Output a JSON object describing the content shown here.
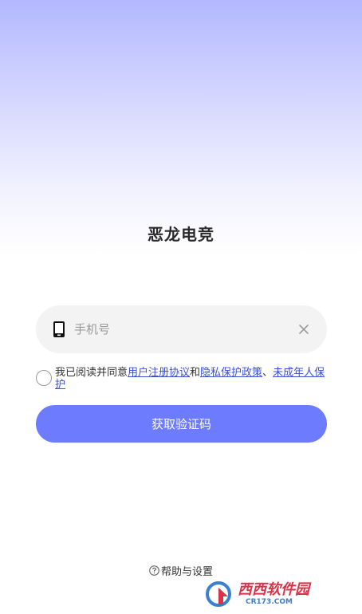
{
  "app": {
    "title": "恶龙电竞"
  },
  "phone_input": {
    "placeholder": "手机号",
    "value": "",
    "icon": "phone-icon",
    "clear_icon": "close-icon"
  },
  "agreement": {
    "checked": false,
    "prefix": "我已阅读并同意",
    "link_user_agreement": "用户注册协议",
    "and": "和",
    "link_privacy_policy": "隐私保护政策",
    "separator": "、",
    "link_minor_protection": "未成年人保护"
  },
  "actions": {
    "get_code_label": "获取验证码"
  },
  "footer": {
    "help_icon": "question-circle-icon",
    "help_label": "帮助与设置"
  },
  "watermark": {
    "main": "西西软件园",
    "sub": "CR173.COM"
  },
  "colors": {
    "accent": "#6d7cff",
    "link": "#3b4fd8",
    "input_bg": "#f3f3f3",
    "gradient_top": "#b3b8ff"
  }
}
